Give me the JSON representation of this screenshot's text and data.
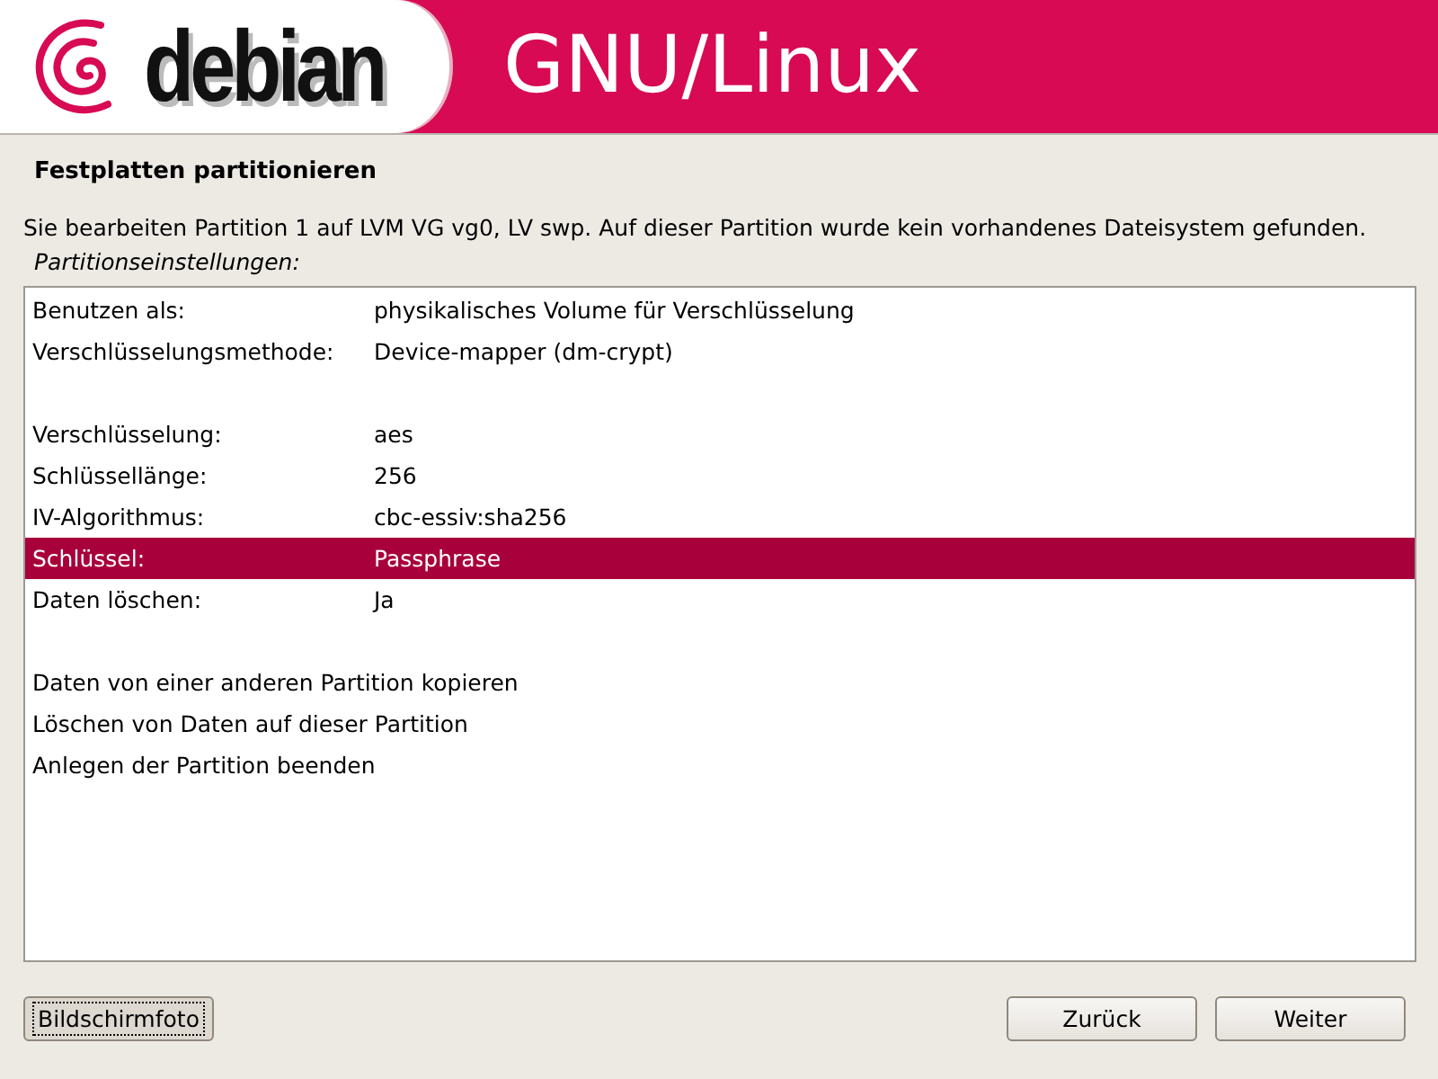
{
  "banner": {
    "logo_text": "debian",
    "title": "GNU/Linux"
  },
  "heading": "Festplatten partitionieren",
  "description": "Sie bearbeiten Partition 1 auf LVM VG vg0, LV swp. Auf dieser Partition wurde kein vorhandenes Dateisystem gefunden.",
  "list_label": "Partitionseinstellungen:",
  "rows": [
    {
      "kind": "setting",
      "label": "Benutzen als:",
      "value": "physikalisches Volume für Verschlüsselung",
      "selected": false
    },
    {
      "kind": "setting",
      "label": "Verschlüsselungsmethode:",
      "value": "Device-mapper (dm-crypt)",
      "selected": false
    },
    {
      "kind": "blank"
    },
    {
      "kind": "setting",
      "label": "Verschlüsselung:",
      "value": "aes",
      "selected": false
    },
    {
      "kind": "setting",
      "label": "Schlüssellänge:",
      "value": "256",
      "selected": false
    },
    {
      "kind": "setting",
      "label": "IV-Algorithmus:",
      "value": "cbc-essiv:sha256",
      "selected": false
    },
    {
      "kind": "setting",
      "label": "Schlüssel:",
      "value": "Passphrase",
      "selected": true
    },
    {
      "kind": "setting",
      "label": "Daten löschen:",
      "value": "Ja",
      "selected": false
    },
    {
      "kind": "blank"
    },
    {
      "kind": "action",
      "label": "Daten von einer anderen Partition kopieren",
      "selected": false
    },
    {
      "kind": "action",
      "label": "Löschen von Daten auf dieser Partition",
      "selected": false
    },
    {
      "kind": "action",
      "label": "Anlegen der Partition beenden",
      "selected": false
    }
  ],
  "buttons": [
    {
      "label": "Bildschirmfoto",
      "focused": true
    },
    {
      "label": "Zurück",
      "focused": false
    },
    {
      "label": "Weiter",
      "focused": false
    }
  ]
}
